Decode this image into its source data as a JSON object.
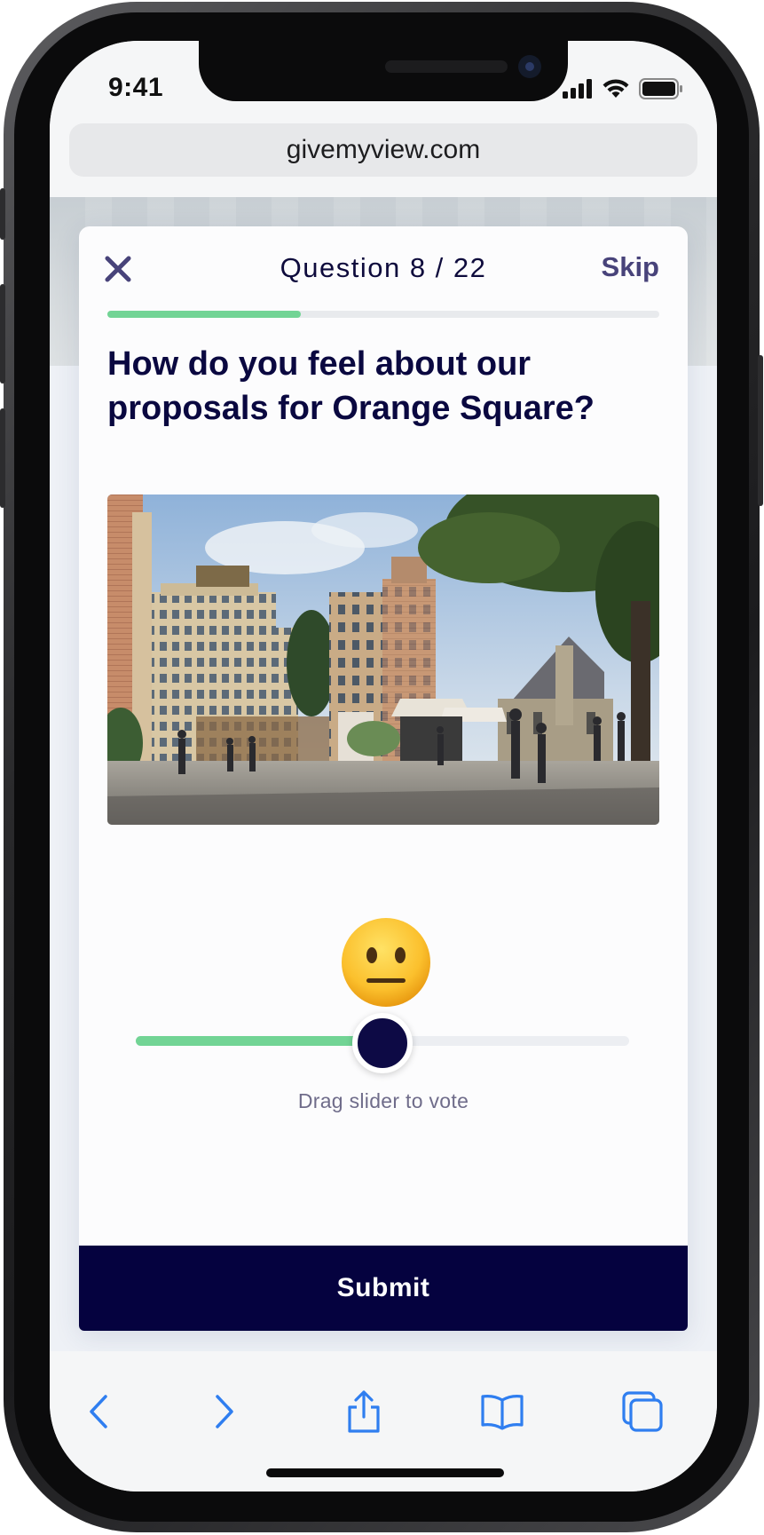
{
  "status_bar": {
    "time": "9:41"
  },
  "browser": {
    "url": "givemyview.com"
  },
  "survey": {
    "counter": "Question 8 / 22",
    "skip_label": "Skip",
    "progress_fraction": 0.35,
    "question": "How do you feel about our proposals for Orange Square?",
    "slider_value_fraction": 0.5,
    "slider_hint": "Drag slider to vote",
    "submit_label": "Submit"
  },
  "toolbar": {
    "icons": [
      "back-icon",
      "forward-icon",
      "share-icon",
      "bookmarks-icon",
      "tabs-icon"
    ]
  },
  "colors": {
    "primary": "#05023f",
    "accent_green": "#72d495",
    "ios_blue": "#2f7ef0",
    "skip_text": "#48437a"
  }
}
